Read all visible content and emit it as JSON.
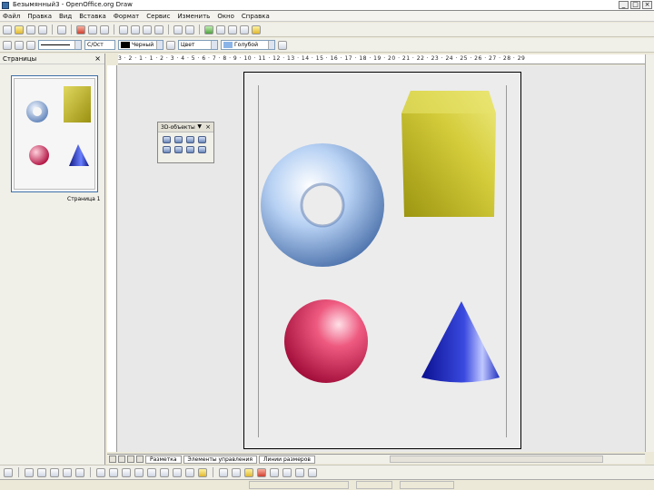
{
  "window": {
    "title": "Безымянный3 - OpenOffice.org Draw"
  },
  "menubar": [
    "Файл",
    "Правка",
    "Вид",
    "Вставка",
    "Формат",
    "Сервис",
    "Изменить",
    "Окно",
    "Справка"
  ],
  "toolbar2": {
    "line_color": "С/Ост",
    "fill_color": "Черный",
    "area_style": "Цвет",
    "color_name": "Голубой"
  },
  "pages_panel": {
    "title": "Страницы",
    "slide_label": "Страница 1"
  },
  "floating_toolbar": {
    "title": "3D-объекты"
  },
  "ruler": {
    "top_ticks": "3 · 2 · 1 · 1 · 2 · 3 · 4 · 5 · 6 · 7 · 8 · 9 · 10 · 11 · 12 · 13 · 14 · 15 · 16 · 17 · 18 · 19 · 20 · 21 · 22 · 23 · 24 · 25 · 26 · 27 · 28 · 29"
  },
  "tabs": [
    "Разметка",
    "Элементы управления",
    "Линии размеров"
  ],
  "status": {
    "cell1": "",
    "cell2": "",
    "cell3": ""
  },
  "shapes": [
    {
      "name": "torus",
      "color": "#8ab4e8"
    },
    {
      "name": "cube",
      "color": "#c9c12a"
    },
    {
      "name": "sphere",
      "color": "#e0406a"
    },
    {
      "name": "cone",
      "color": "#2030c0"
    }
  ]
}
